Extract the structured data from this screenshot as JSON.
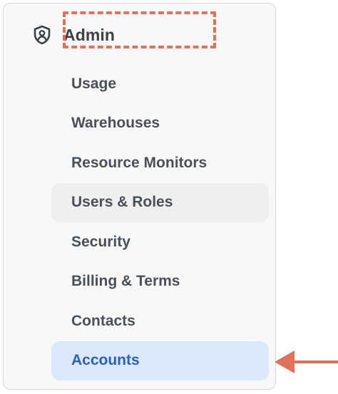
{
  "section": {
    "title": "Admin",
    "icon": "shield-user-icon"
  },
  "nav": {
    "items": [
      {
        "label": "Usage",
        "state": "default"
      },
      {
        "label": "Warehouses",
        "state": "default"
      },
      {
        "label": "Resource Monitors",
        "state": "default"
      },
      {
        "label": "Users & Roles",
        "state": "hover"
      },
      {
        "label": "Security",
        "state": "default"
      },
      {
        "label": "Billing & Terms",
        "state": "default"
      },
      {
        "label": "Contacts",
        "state": "default"
      },
      {
        "label": "Accounts",
        "state": "active"
      }
    ]
  },
  "annotations": {
    "highlight_color": "#e0715a",
    "arrow_color": "#e0715a",
    "active_bg": "#dce8fb",
    "active_text": "#2b5fc4"
  }
}
